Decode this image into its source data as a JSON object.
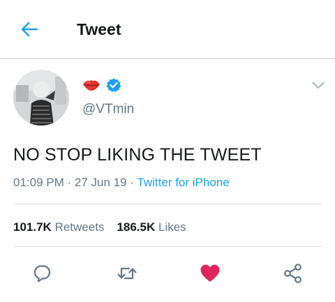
{
  "header": {
    "title": "Tweet",
    "back_icon": "arrow-left-icon"
  },
  "author": {
    "display_name_icons": [
      "lips-kiss-icon",
      "verified-badge-icon"
    ],
    "handle": "@VTmin",
    "avatar_icon": "profile-photo"
  },
  "tweet": {
    "text": "NO STOP LIKING THE TWEET",
    "time": "01:09 PM",
    "date": "27 Jun 19",
    "separator": "·",
    "source": "Twitter for iPhone"
  },
  "stats": {
    "retweets_count": "101.7K",
    "retweets_label": "Retweets",
    "likes_count": "186.5K",
    "likes_label": "Likes"
  },
  "actions": {
    "reply_icon": "reply-icon",
    "retweet_icon": "retweet-icon",
    "like_icon": "heart-icon",
    "share_icon": "share-icon",
    "liked": true
  },
  "colors": {
    "accent": "#1da1f2",
    "like": "#e0245e",
    "text": "#14171a",
    "muted": "#657786",
    "verified": "#1da1f2"
  }
}
